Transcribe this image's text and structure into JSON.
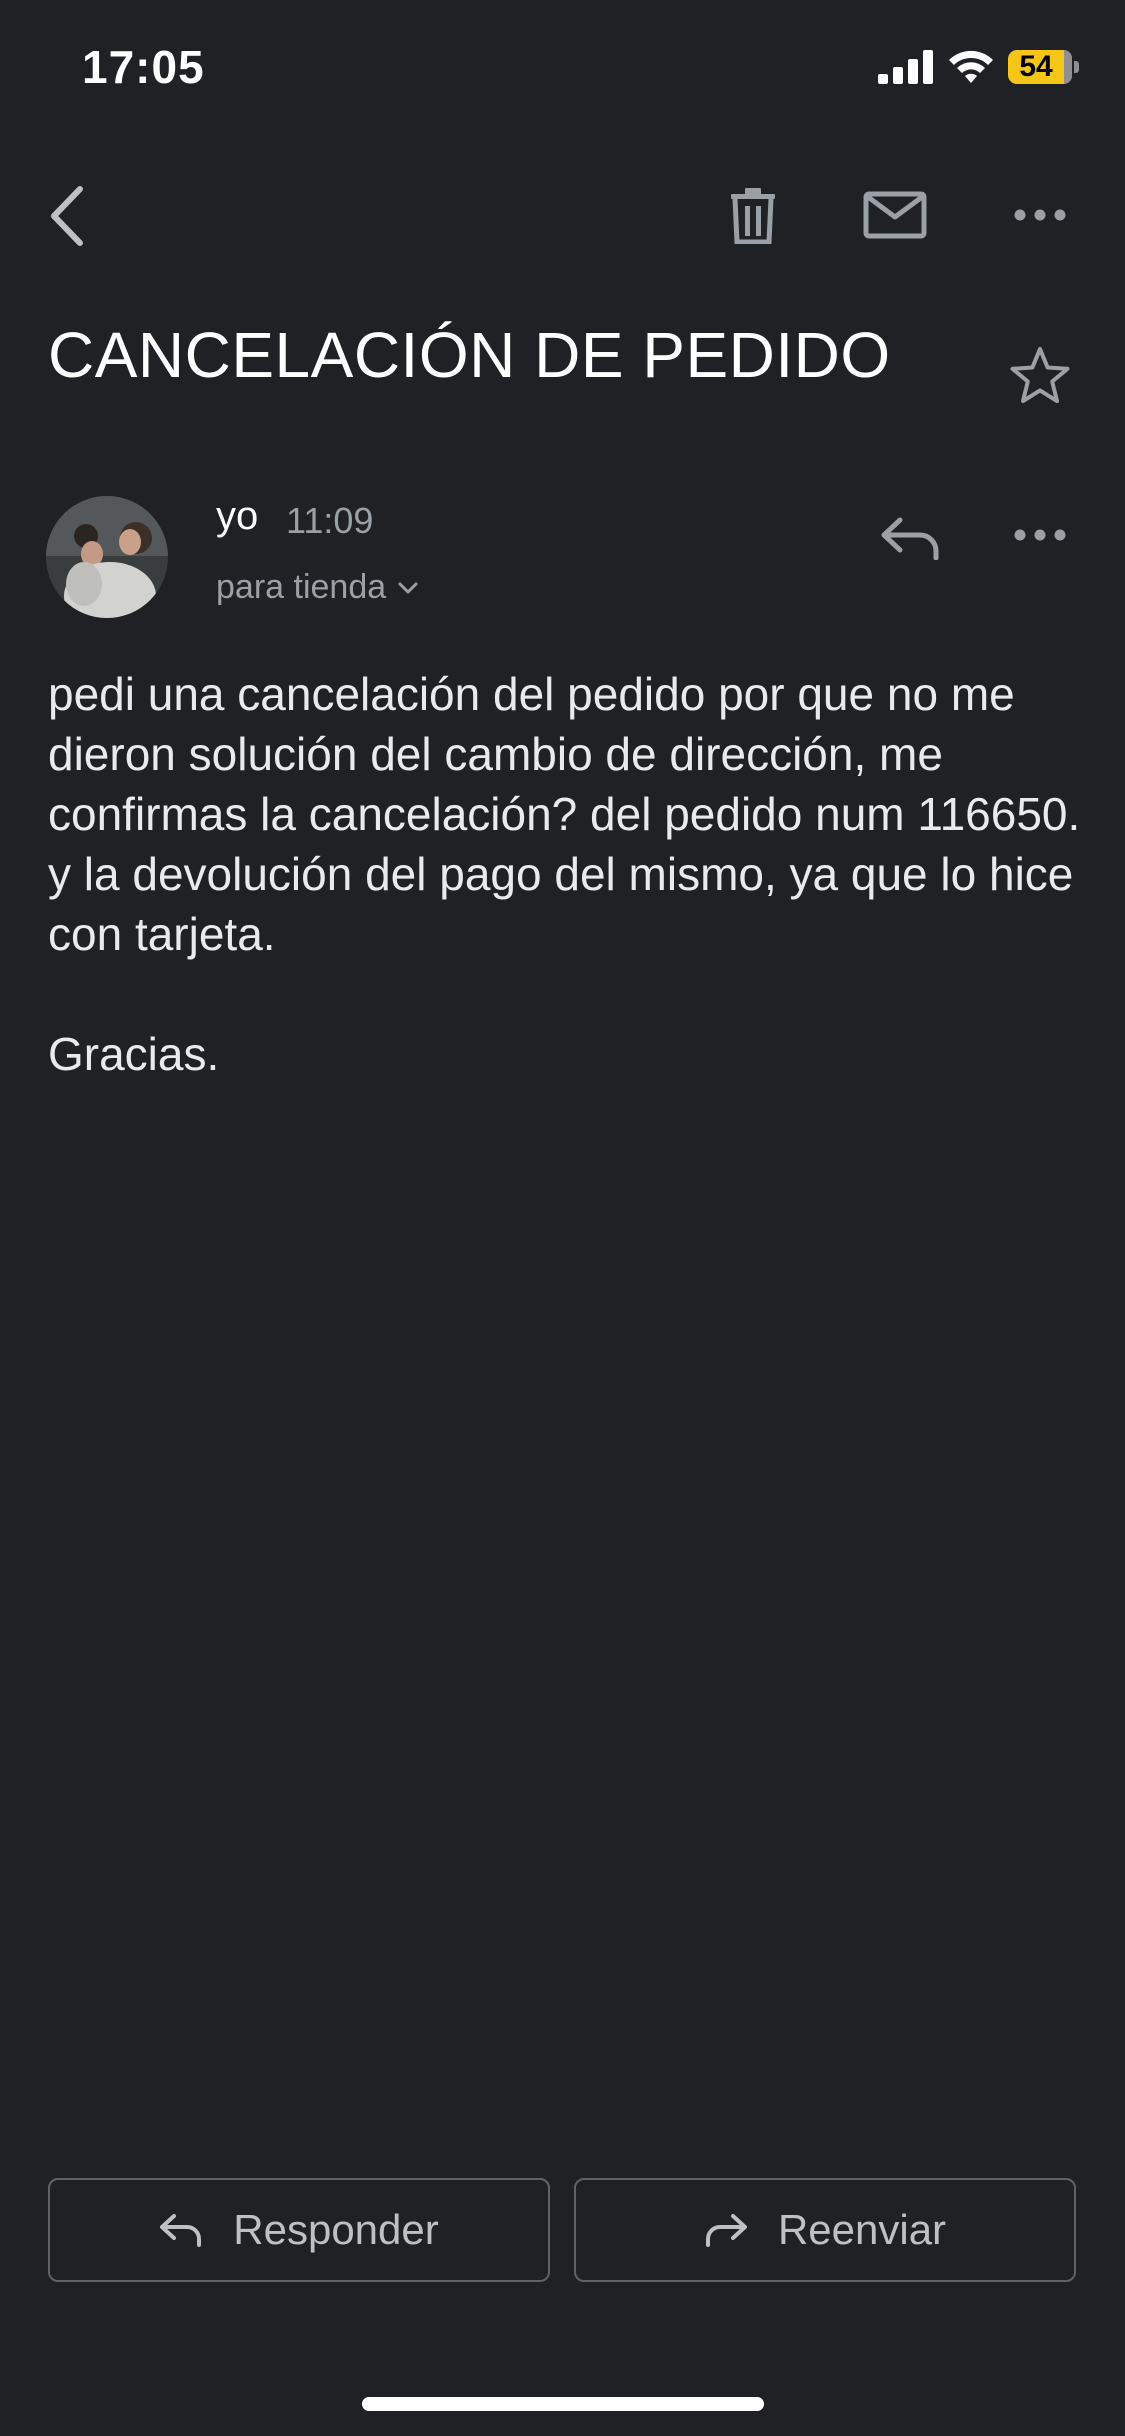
{
  "status_bar": {
    "time": "17:05",
    "battery": "54"
  },
  "icons": {
    "back": "chevron-left-icon",
    "trash": "trash-icon",
    "mail": "mail-icon",
    "more": "more-horizontal-icon",
    "star": "star-icon",
    "reply": "reply-icon",
    "forward": "forward-icon"
  },
  "email": {
    "subject": "CANCELACIÓN DE PEDIDO",
    "sender": "yo",
    "time": "11:09",
    "recipient": "para tienda",
    "body": "pedi una cancelación del pedido por que no me dieron solución del cambio de dirección, me confirmas la cancelación? del pedido num 116650. y la devolución del pago del mismo, ya que lo hice con tarjeta.",
    "signoff": "Gracias."
  },
  "actions": {
    "reply_label": "Responder",
    "forward_label": "Reenviar"
  },
  "colors": {
    "background": "#202124",
    "text": "#e8eaed",
    "muted": "#9aa0a6",
    "battery": "#f5c518"
  }
}
